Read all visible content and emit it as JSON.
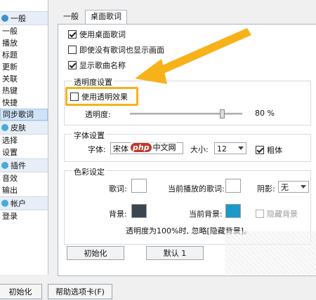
{
  "colors": {
    "accent_highlight": "#f7b21a",
    "bg_swatch": "#3a4650",
    "current_bg_swatch": "#1a9ac8"
  },
  "sidebar": {
    "groups": [
      {
        "title": "一般",
        "icon": "general-icon",
        "color": "#3e8ed8",
        "items": [
          "一般",
          "播放",
          "标题",
          "更新",
          "关联",
          "热键",
          "快捷",
          "同步歌词"
        ]
      },
      {
        "title": "皮肤",
        "icon": "skin-icon",
        "color": "#4aa8e0",
        "items": [
          "选择",
          "设置"
        ]
      },
      {
        "title": "插件",
        "icon": "plugin-icon",
        "color": "#4aa8e0",
        "items": [
          "音效",
          "输出"
        ]
      },
      {
        "title": "帐户",
        "icon": "account-icon",
        "color": "#4aa8e0",
        "items": [
          "登录"
        ]
      }
    ],
    "active_item": "同步歌词"
  },
  "tabs": [
    "一般",
    "桌面歌词"
  ],
  "active_tab": "桌面歌词",
  "options": {
    "use_desktop_lyrics": "使用桌面歌词",
    "show_when_no_lyrics": "即使没有歌词也显示画面",
    "show_song_name": "显示歌曲名称"
  },
  "transparency": {
    "section_title": "透明度设置",
    "use_transparent": "使用透明效果",
    "label": "透明度:",
    "value": "80 %",
    "level_fraction": 0.8
  },
  "font": {
    "section_title": "字体设置",
    "label": "字体:",
    "name": "宋体",
    "size_label": "大小:",
    "size": "12",
    "bold": "粗体"
  },
  "color": {
    "section_title": "色彩设定",
    "lyrics": "歌词:",
    "current_lyrics": "当前播放的歌词:",
    "shadow": "阴影:",
    "shadow_value": "无",
    "background": "背景:",
    "current_background": "当前背景:",
    "hide_background": "隐藏背景",
    "note": "透明度为100%时, 忽略[隐藏背景]。"
  },
  "buttons": {
    "init": "初始化",
    "default": "默认 1"
  },
  "bottom": {
    "init": "初始化",
    "help": "帮助选项卡(F)"
  },
  "watermark": {
    "logo": "php",
    "text": "中文网"
  }
}
